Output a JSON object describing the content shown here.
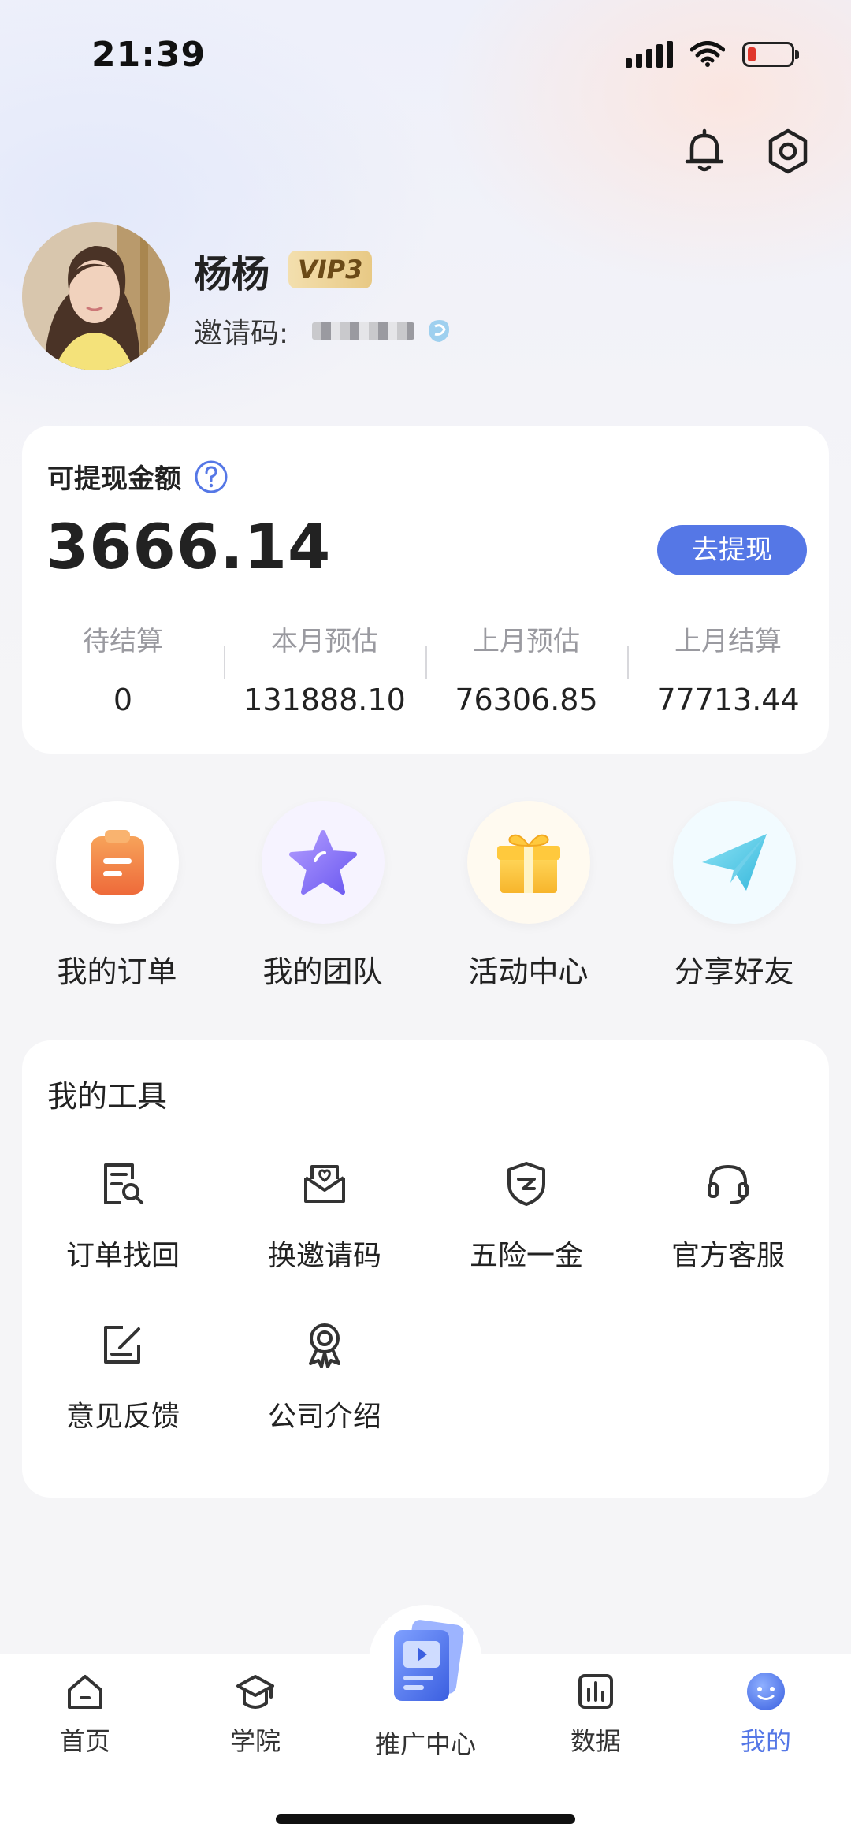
{
  "status_bar": {
    "time": "21:39"
  },
  "profile": {
    "name": "杨杨",
    "vip": "VIP3",
    "invite_label": "邀请码:"
  },
  "balance": {
    "label": "可提现金额",
    "amount": "3666.14",
    "withdraw_label": "去提现",
    "stats": [
      {
        "label": "待结算",
        "value": "0"
      },
      {
        "label": "本月预估",
        "value": "131888.10"
      },
      {
        "label": "上月预估",
        "value": "76306.85"
      },
      {
        "label": "上月结算",
        "value": "77713.44"
      }
    ]
  },
  "quick_actions": [
    {
      "label": "我的订单",
      "icon": "order-icon"
    },
    {
      "label": "我的团队",
      "icon": "star-icon"
    },
    {
      "label": "活动中心",
      "icon": "gift-icon"
    },
    {
      "label": "分享好友",
      "icon": "paper-plane-icon"
    }
  ],
  "tools": {
    "title": "我的工具",
    "items": [
      {
        "label": "订单找回",
        "icon": "document-search-icon"
      },
      {
        "label": "换邀请码",
        "icon": "envelope-heart-icon"
      },
      {
        "label": "五险一金",
        "icon": "shield-icon"
      },
      {
        "label": "官方客服",
        "icon": "headset-icon"
      },
      {
        "label": "意见反馈",
        "icon": "feedback-edit-icon"
      },
      {
        "label": "公司介绍",
        "icon": "award-badge-icon"
      }
    ]
  },
  "nav": {
    "items": [
      {
        "label": "首页",
        "icon": "home-icon"
      },
      {
        "label": "学院",
        "icon": "graduation-cap-icon"
      },
      {
        "label": "推广中心",
        "icon": "promo-center-icon"
      },
      {
        "label": "数据",
        "icon": "bar-chart-icon"
      },
      {
        "label": "我的",
        "icon": "smiley-icon"
      }
    ],
    "active_color": "#5577e6"
  },
  "colors": {
    "accent": "#5577e6",
    "vip_gold": "#e8c985"
  }
}
